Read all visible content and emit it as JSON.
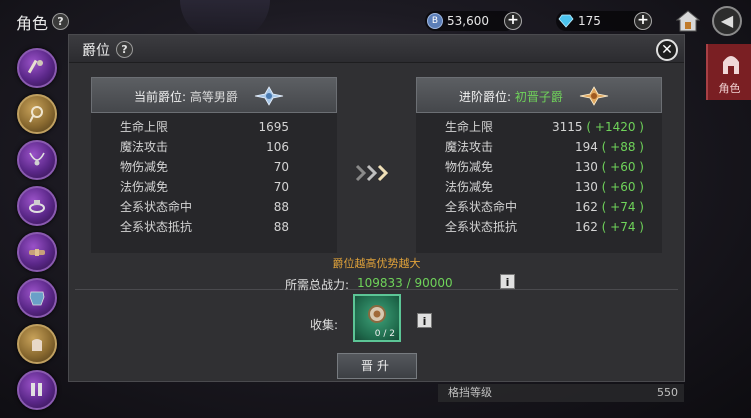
{
  "topbar": {
    "title": "角色",
    "help": "?",
    "gold": {
      "value": "53,600",
      "icon": "B"
    },
    "gem": {
      "value": "175"
    },
    "plus": "+",
    "back": "◀"
  },
  "side_tab": {
    "label": "角色"
  },
  "panel": {
    "title": "爵位",
    "help": "?",
    "close": "✕",
    "current": {
      "label": "当前爵位:",
      "rank": "高等男爵",
      "stats": [
        {
          "name": "生命上限",
          "value": "1695"
        },
        {
          "name": "魔法攻击",
          "value": "106"
        },
        {
          "name": "物伤减免",
          "value": "70"
        },
        {
          "name": "法伤减免",
          "value": "70"
        },
        {
          "name": "全系状态命中",
          "value": "88"
        },
        {
          "name": "全系状态抵抗",
          "value": "88"
        }
      ]
    },
    "next": {
      "label": "进阶爵位:",
      "rank": "初晋子爵",
      "stats": [
        {
          "name": "生命上限",
          "value": "3115",
          "inc": "( +1420 )"
        },
        {
          "name": "魔法攻击",
          "value": "194",
          "inc": "( +88 )"
        },
        {
          "name": "物伤减免",
          "value": "130",
          "inc": "( +60 )"
        },
        {
          "name": "法伤减免",
          "value": "130",
          "inc": "( +60 )"
        },
        {
          "name": "全系状态命中",
          "value": "162",
          "inc": "( +74 )"
        },
        {
          "name": "全系状态抵抗",
          "value": "162",
          "inc": "( +74 )"
        }
      ]
    },
    "hint": "爵位越高优势越大",
    "power_label": "所需总战力:",
    "power_value": "109833 / 90000",
    "info": "i",
    "collect_label": "收集:",
    "collect_count": "0 / 2",
    "promote": "晋升"
  },
  "background_list": {
    "name": "格挡等级",
    "value": "550"
  },
  "colors": {
    "accent_green": "#6fd35a",
    "hint_orange": "#e0a23a",
    "tab_red": "#7a1f23"
  }
}
